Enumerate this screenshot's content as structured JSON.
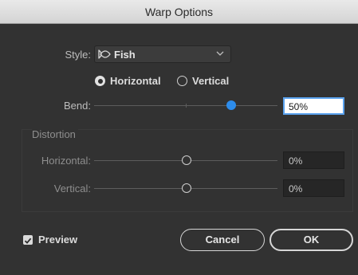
{
  "window": {
    "title": "Warp Options"
  },
  "style": {
    "label": "Style:",
    "value": "Fish",
    "icon": "fish-icon"
  },
  "orientation": {
    "options": [
      {
        "label": "Horizontal",
        "selected": true
      },
      {
        "label": "Vertical",
        "selected": false
      }
    ]
  },
  "bend": {
    "label": "Bend:",
    "value": "50%",
    "level": 50
  },
  "distortion": {
    "title": "Distortion",
    "horizontal": {
      "label": "Horizontal:",
      "value": "0%",
      "level": 0
    },
    "vertical": {
      "label": "Vertical:",
      "value": "0%",
      "level": 0
    }
  },
  "preview": {
    "label": "Preview",
    "checked": true
  },
  "buttons": {
    "cancel": "Cancel",
    "ok": "OK"
  },
  "colors": {
    "accent": "#2d8ceb",
    "focus_ring": "#5aa2ee"
  }
}
